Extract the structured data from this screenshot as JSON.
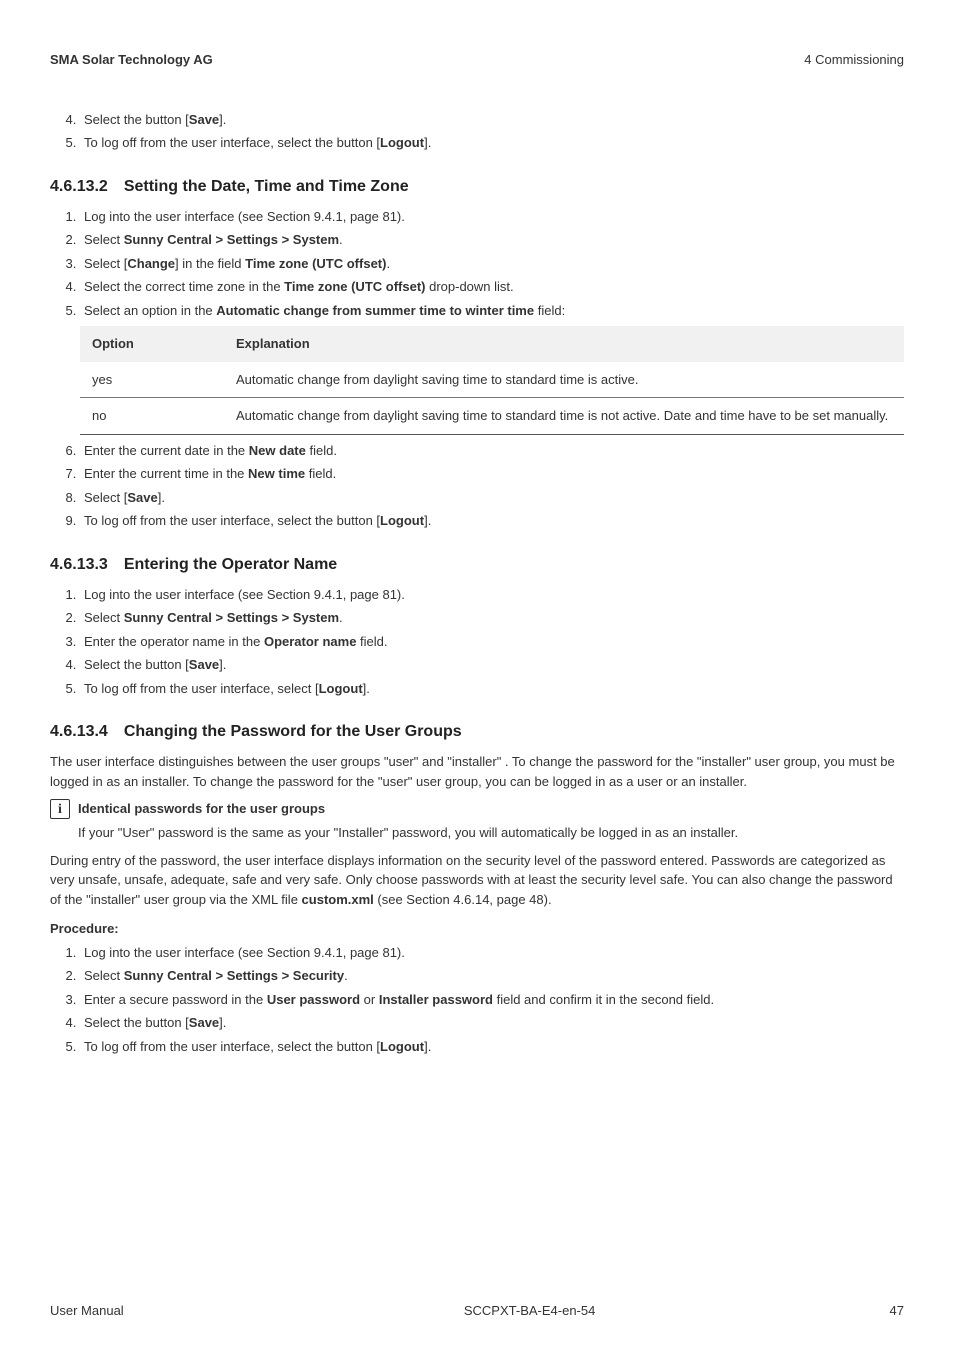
{
  "header": {
    "left": "SMA Solar Technology AG",
    "right": "4 Commissioning"
  },
  "start_index": 4,
  "pre_steps": [
    {
      "pre": "Select the button [",
      "bold": "Save",
      "post": "]."
    },
    {
      "pre": "To log off from the user interface, select the button [",
      "bold": "Logout",
      "post": "]."
    }
  ],
  "s2": {
    "heading": "4.6.13.2 Setting the Date, Time and Time Zone",
    "steps_a": [
      {
        "text": "Log into the user interface (see Section 9.4.1, page 81)."
      },
      {
        "pre": "Select ",
        "bold": "Sunny Central > Settings > System",
        "post": "."
      },
      {
        "pre": "Select [",
        "bold": "Change",
        "mid": "] in the field ",
        "bold2": "Time zone (UTC offset)",
        "post2": "."
      },
      {
        "pre": "Select the correct time zone in the ",
        "bold": "Time zone (UTC offset)",
        "post": " drop-down list."
      },
      {
        "pre": "Select an option in the ",
        "bold": "Automatic change from summer time to winter time",
        "post": " field:"
      }
    ],
    "table": {
      "h1": "Option",
      "h2": "Explanation",
      "rows": [
        {
          "opt": "yes",
          "exp": "Automatic change from daylight saving time to standard time is active."
        },
        {
          "opt": "no",
          "exp": "Automatic change from daylight saving time to standard time is not active. Date and time have to be set manually."
        }
      ]
    },
    "steps_b_start": 6,
    "steps_b": [
      {
        "pre": "Enter the current date in the ",
        "bold": "New date",
        "post": " field."
      },
      {
        "pre": "Enter the current time in the ",
        "bold": "New time",
        "post": " field."
      },
      {
        "pre": "Select [",
        "bold": "Save",
        "post": "]."
      },
      {
        "pre": "To log off from the user interface, select the button [",
        "bold": "Logout",
        "post": "]."
      }
    ]
  },
  "s3": {
    "heading": "4.6.13.3 Entering the Operator Name",
    "steps": [
      {
        "text": "Log into the user interface (see Section 9.4.1, page 81)."
      },
      {
        "pre": "Select ",
        "bold": "Sunny Central > Settings > System",
        "post": "."
      },
      {
        "pre": "Enter the operator name in the ",
        "bold": "Operator name",
        "post": " field."
      },
      {
        "pre": "Select the button [",
        "bold": "Save",
        "post": "]."
      },
      {
        "pre": "To log off from the user interface, select [",
        "bold": "Logout",
        "post": "]."
      }
    ]
  },
  "s4": {
    "heading": "4.6.13.4 Changing the Password for the User Groups",
    "para1": "The user interface distinguishes between the user groups \"user\" and \"installer\" . To change the password for the \"installer\" user group, you must be logged in as an installer. To change the password for the \"user\" user group, you can be logged in as a user or an installer.",
    "info_title": "Identical passwords for the user groups",
    "info_body": "If your \"User\" password is the same as your \"Installer\" password, you will automatically be logged in as an installer.",
    "para2_pre": "During entry of the password, the user interface displays information on the security level of the password entered. Passwords are categorized as very unsafe, unsafe, adequate, safe and very safe. Only choose passwords with at least the security level safe. You can also change the password of the \"installer\" user group via the XML file ",
    "para2_bold": "custom.xml",
    "para2_post": " (see Section 4.6.14, page 48).",
    "proc_label": "Procedure:",
    "steps": [
      {
        "text": "Log into the user interface (see Section 9.4.1, page 81)."
      },
      {
        "pre": "Select ",
        "bold": "Sunny Central > Settings > Security",
        "post": "."
      },
      {
        "pre": "Enter a secure password in the ",
        "bold": "User password",
        "mid": " or ",
        "bold2": "Installer password",
        "post2": " field and confirm it in the second field."
      },
      {
        "pre": "Select the button [",
        "bold": "Save",
        "post": "]."
      },
      {
        "pre": "To log off from the user interface, select the button [",
        "bold": "Logout",
        "post": "]."
      }
    ]
  },
  "footer": {
    "left": "User Manual",
    "center": "SCCPXT-BA-E4-en-54",
    "right": "47"
  }
}
